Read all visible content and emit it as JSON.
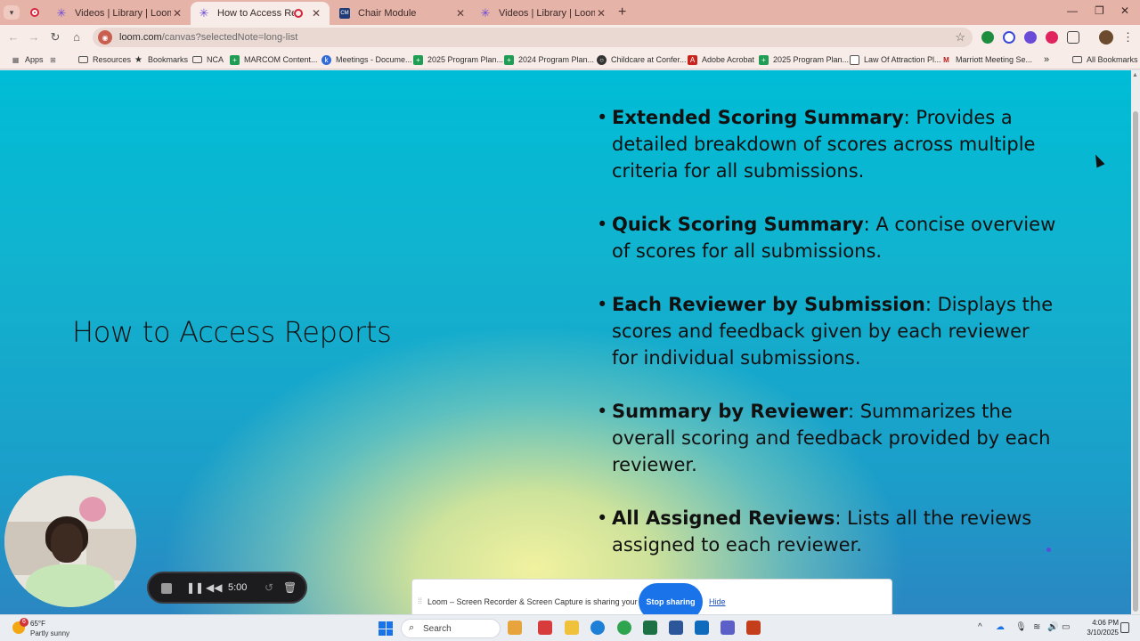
{
  "browser": {
    "tabs": [
      {
        "title": "Videos | Library | Loom",
        "active": false
      },
      {
        "title": "How to Access Reports",
        "active": true
      },
      {
        "title": "Chair Module",
        "active": false
      },
      {
        "title": "Videos | Library | Loom",
        "active": false
      }
    ],
    "url_host": "loom.com",
    "url_path": "/canvas?selectedNote=long-list",
    "bookmarks": [
      {
        "label": "Apps",
        "icon": "apps-grid-icon"
      },
      {
        "label": "Resources",
        "icon": "folder-icon"
      },
      {
        "label": "Bookmarks",
        "icon": "star-icon"
      },
      {
        "label": "NCA",
        "icon": "folder-icon"
      },
      {
        "label": "MARCOM Content...",
        "icon": "sheets-icon"
      },
      {
        "label": "Meetings - Docume...",
        "icon": "meetings-icon"
      },
      {
        "label": "2025 Program Plan...",
        "icon": "sheets-icon"
      },
      {
        "label": "2024 Program Plan...",
        "icon": "sheets-icon"
      },
      {
        "label": "Childcare at Confer...",
        "icon": "globe-icon"
      },
      {
        "label": "Adobe Acrobat",
        "icon": "acrobat-icon"
      },
      {
        "label": "2025 Program Plan...",
        "icon": "sheets-icon"
      },
      {
        "label": "Law Of Attraction Pl...",
        "icon": "page-icon"
      },
      {
        "label": "Marriott Meeting Se...",
        "icon": "marriott-icon"
      }
    ],
    "more_bookmarks": "»",
    "all_bookmarks": "All Bookmarks"
  },
  "slide": {
    "title": "How to Access Reports",
    "items": [
      {
        "term": "Extended Scoring Summary",
        "desc": ": Provides a detailed breakdown of scores across multiple criteria for all submissions."
      },
      {
        "term": "Quick Scoring Summary",
        "desc": ": A concise overview of scores for all submissions."
      },
      {
        "term": "Each Reviewer by Submission",
        "desc": ": Displays the scores and feedback given by each reviewer for individual submissions."
      },
      {
        "term": "Summary by Reviewer",
        "desc": ": Summarizes the overall scoring and feedback provided by each reviewer."
      },
      {
        "term": "All Assigned Reviews",
        "desc": ": Lists all the reviews assigned to each reviewer."
      }
    ]
  },
  "loom": {
    "timer": "5:00",
    "share_message": "Loom – Screen Recorder & Screen Capture is sharing your screen.",
    "stop_label": "Stop sharing",
    "hide_label": "Hide"
  },
  "taskbar": {
    "weather_badge": "6",
    "temperature": "65°F",
    "condition": "Partly sunny",
    "search_label": "Search",
    "time": "4:06 PM",
    "date": "3/10/2025"
  },
  "colors": {
    "tab_strip": "#e6b3a8",
    "toolbar": "#f8ece9",
    "slide_top": "#00bcd6",
    "slide_glow": "#f1f2a0",
    "stop_button": "#1a73e8",
    "recording_red": "#d6263b"
  }
}
